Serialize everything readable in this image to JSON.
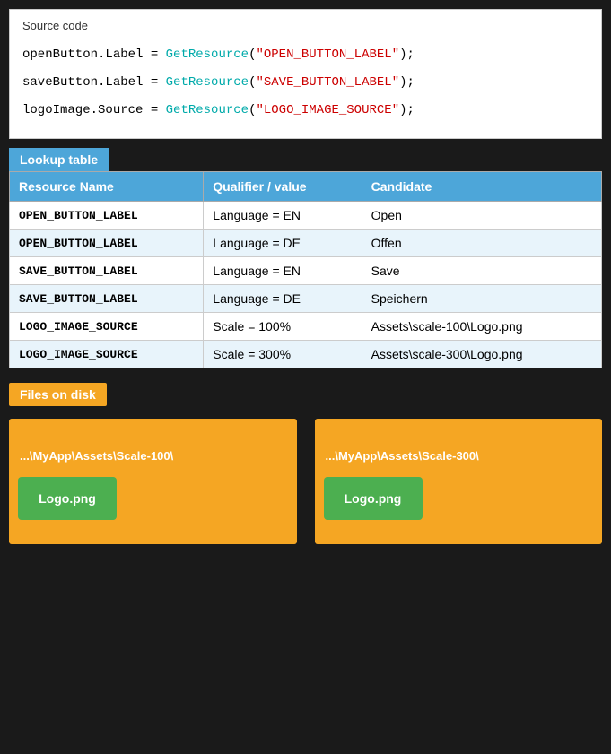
{
  "sourceCode": {
    "title": "Source code",
    "lines": [
      {
        "prefix": "openButton.Label = ",
        "fn": "GetResource",
        "arg": "\"OPEN_BUTTON_LABEL\""
      },
      {
        "prefix": "saveButton.Label = ",
        "fn": "GetResource",
        "arg": "\"SAVE_BUTTON_LABEL\""
      },
      {
        "prefix": "logoImage.Source = ",
        "fn": "GetResource",
        "arg": "\"LOGO_IMAGE_SOURCE\""
      }
    ]
  },
  "lookupTable": {
    "title": "Lookup table",
    "columns": [
      "Resource Name",
      "Qualifier / value",
      "Candidate"
    ],
    "rows": [
      {
        "resourceName": "OPEN_BUTTON_LABEL",
        "qualifier": "Language = EN",
        "candidate": "Open"
      },
      {
        "resourceName": "OPEN_BUTTON_LABEL",
        "qualifier": "Language = DE",
        "candidate": "Offen"
      },
      {
        "resourceName": "SAVE_BUTTON_LABEL",
        "qualifier": "Language = EN",
        "candidate": "Save"
      },
      {
        "resourceName": "SAVE_BUTTON_LABEL",
        "qualifier": "Language = DE",
        "candidate": "Speichern"
      },
      {
        "resourceName": "LOGO_IMAGE_SOURCE",
        "qualifier": "Scale = 100%",
        "candidate": "Assets\\scale-100\\Logo.png"
      },
      {
        "resourceName": "LOGO_IMAGE_SOURCE",
        "qualifier": "Scale = 300%",
        "candidate": "Assets\\scale-300\\Logo.png"
      }
    ]
  },
  "filesOnDisk": {
    "title": "Files on disk",
    "folders": [
      {
        "path": "...\\MyApp\\Assets\\Scale-100\\",
        "file": "Logo.png"
      },
      {
        "path": "...\\MyApp\\Assets\\Scale-300\\",
        "file": "Logo.png"
      }
    ]
  }
}
